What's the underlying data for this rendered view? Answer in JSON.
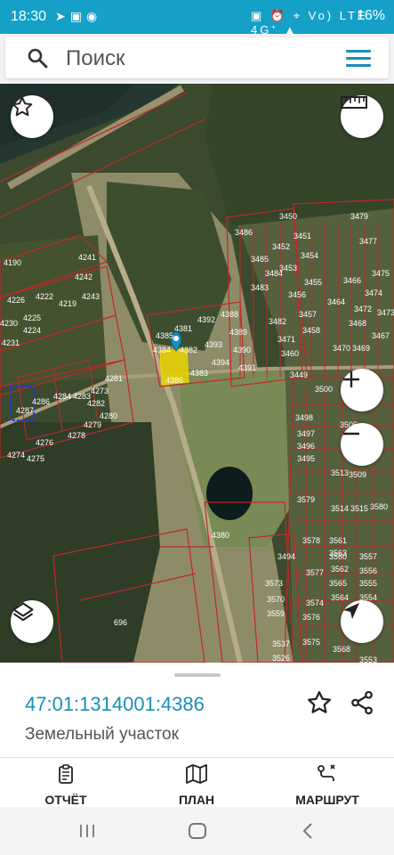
{
  "status_bar": {
    "time": "18:30",
    "left_icons": [
      "telegram-icon",
      "gallery-icon",
      "whatsapp-icon"
    ],
    "right_icons_text": "▣ ⏰ ⌖ Vo) LTE 4G⁺ ▲",
    "battery": "16%"
  },
  "search": {
    "placeholder": "Поиск"
  },
  "map": {
    "accent_color": "#1a8fb8",
    "parcel_line_color": "#c0282a",
    "selected_parcel": "4386",
    "buttons": [
      "favorite-star-icon",
      "ruler-icon",
      "zoom-in-icon",
      "zoom-out-icon",
      "layers-icon",
      "locate-arrow-icon"
    ],
    "labels": [
      "4190",
      "4241",
      "4242",
      "4226",
      "4222",
      "4219",
      "4243",
      "4230",
      "4225",
      "4224",
      "4231",
      "4385",
      "4381",
      "4392",
      "4388",
      "4384",
      "4382",
      "4393",
      "4389",
      "4383",
      "4390",
      "4394",
      "4391",
      "4386",
      "4273",
      "4281",
      "4284",
      "4283",
      "4282",
      "4286",
      "4287",
      "4280",
      "4279",
      "4278",
      "4276",
      "4274",
      "4275",
      "3486",
      "3450",
      "3452",
      "3451",
      "3479",
      "3477",
      "3475",
      "3485",
      "3484",
      "3483",
      "3453",
      "3454",
      "3474",
      "3473",
      "3456",
      "3455",
      "3464",
      "3466",
      "3482",
      "3457",
      "3472",
      "3471",
      "3468",
      "3460",
      "3458",
      "3470",
      "3469",
      "3467",
      "3449",
      "3500",
      "3498",
      "3497",
      "3496",
      "3495",
      "3505",
      "3510",
      "3513",
      "3509",
      "3514",
      "3515",
      "3579",
      "3580",
      "3578",
      "3561",
      "3494",
      "3577",
      "3574",
      "3560",
      "3563",
      "3557",
      "3562",
      "3556",
      "3565",
      "3555",
      "3564",
      "3554",
      "3573",
      "3570",
      "3576",
      "3559",
      "3575",
      "3537",
      "3526",
      "3568",
      "3553",
      "4380",
      "696"
    ]
  },
  "info": {
    "cadastral_number": "47:01:1314001:4386",
    "type": "Земельный участок"
  },
  "nav": {
    "report": "ОТЧЁТ",
    "plan": "ПЛАН",
    "route": "МАРШРУТ"
  }
}
